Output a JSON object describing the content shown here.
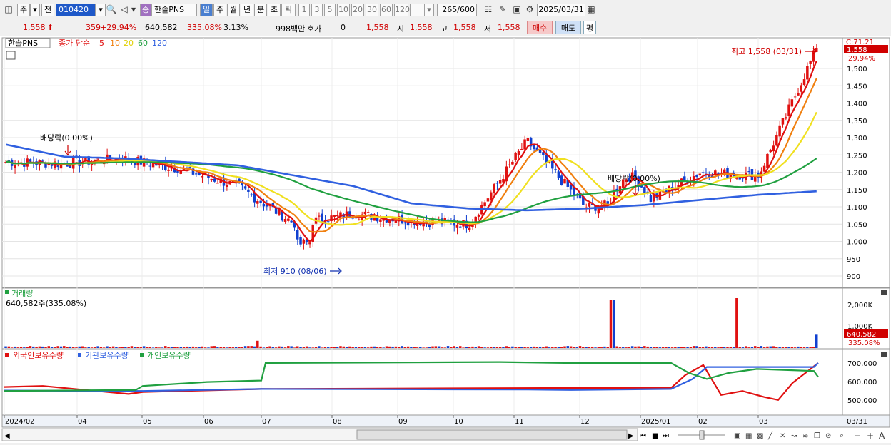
{
  "toolbar": {
    "tab_day": "주",
    "tab_prev": "전",
    "code": "010420",
    "stock_name": "한솔PNS",
    "period_buttons": [
      "일",
      "주",
      "월",
      "년",
      "분",
      "초",
      "틱"
    ],
    "interval_buttons": [
      "1",
      "3",
      "5",
      "10",
      "20",
      "30",
      "60",
      "120"
    ],
    "count_value": "265",
    "count_total": "/600",
    "date": "2025/03/31"
  },
  "quote": {
    "price": "1,558",
    "change": "359",
    "change_pct": "+29.94%",
    "volume": "640,582",
    "volume_pct": "335.08%",
    "turnover_pct": "3.13%",
    "amount": "998백만",
    "hoga_label": "호가",
    "hoga_value": "0",
    "hoga_price": "1,558",
    "open_label": "시",
    "open_value": "1,558",
    "high_label": "고",
    "high_value": "1,558",
    "low_label": "저",
    "low_value": "1,558",
    "buy_label": "매수",
    "sell_label": "매도",
    "eval_label": "평"
  },
  "price_pane": {
    "legend_name": "한솔PNS",
    "legend_main": "종가 단순",
    "ma_periods": [
      "5",
      "10",
      "20",
      "60",
      "120"
    ],
    "ma_colors": [
      "#e01010",
      "#f08010",
      "#f0e020",
      "#20a040",
      "#3060e0"
    ],
    "high_annotation": "최고 1,558 (03/31)",
    "low_annotation": "최저 910 (08/06)",
    "dividend_annotation_1": "배당락(0.00%)",
    "dividend_annotation_2": "배당락(0.00%)",
    "y_ticks": [
      "1,500",
      "1,450",
      "1,400",
      "1,350",
      "1,300",
      "1,250",
      "1,200",
      "1,150",
      "1,100",
      "1,050",
      "1,000",
      "950",
      "900"
    ],
    "y_top_label": "C:71.21",
    "price_tag": "1,558",
    "pct_tag": "29.94%"
  },
  "volume_pane": {
    "title": "거래량",
    "value_text": "640,582주(335.08%)",
    "y_ticks": [
      "2,000K",
      "1,000K"
    ],
    "volume_tag": "640,582",
    "volume_pct_tag": "335.08%"
  },
  "holding_pane": {
    "legend": [
      "외국인보유수량",
      "기관보유수량",
      "개인보유수량"
    ],
    "legend_colors": [
      "#e01010",
      "#3060e0",
      "#20a040"
    ],
    "y_ticks": [
      "700,000",
      "600,000",
      "500,000"
    ]
  },
  "x_axis": {
    "labels": [
      "2024/02",
      "04",
      "05",
      "06",
      "07",
      "08",
      "09",
      "10",
      "11",
      "12",
      "2025/01",
      "02",
      "03"
    ],
    "end_label": "03/31"
  },
  "chart_data": {
    "type": "candlestick",
    "title": "",
    "ylim": [
      880,
      1560
    ],
    "x": [
      "2024/02",
      "04",
      "05",
      "06",
      "07",
      "08",
      "09",
      "10",
      "11",
      "12",
      "2025/01",
      "02",
      "03",
      "03/31"
    ],
    "close": [
      1230,
      1225,
      1240,
      1210,
      1160,
      1050,
      1080,
      1060,
      1050,
      1290,
      1100,
      1110,
      1200,
      1190,
      1558
    ],
    "ma120": [
      1280,
      1245,
      1240,
      1230,
      1220,
      1190,
      1160,
      1110,
      1095,
      1090,
      1095,
      1105,
      1120,
      1135,
      1145
    ]
  }
}
